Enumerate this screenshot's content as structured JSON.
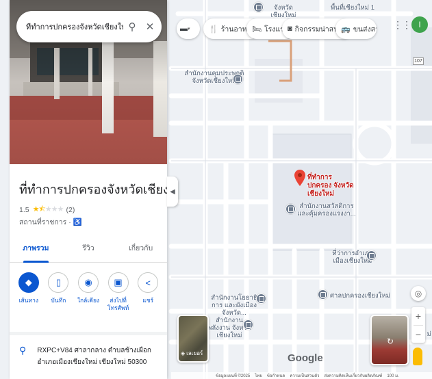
{
  "search": {
    "value": "ที่ทำการปกครองจังหวัดเชียงใหม่",
    "search_icon": "search-icon",
    "close_icon": "close-icon"
  },
  "place": {
    "title": "ที่ทำการปกครองจังหวัดเชียงใหม่",
    "rating": "1.5",
    "reviews": "(2)",
    "stars": 1.5,
    "category": "สถานที่ราชการ ·",
    "accessible_icon": "wheelchair-icon",
    "address": "RXPC+V84 ศาลากลาง ตำบลช้างเผือก อำเภอเมืองเชียงใหม่ เชียงใหม่ 50300"
  },
  "tabs": [
    {
      "label": "ภาพรวม",
      "active": true
    },
    {
      "label": "รีวิว",
      "active": false
    },
    {
      "label": "เกี่ยวกับ",
      "active": false
    }
  ],
  "actions": [
    {
      "label": "เส้นทาง",
      "icon": "directions-icon"
    },
    {
      "label": "บันทึก",
      "icon": "bookmark-icon"
    },
    {
      "label": "ใกล้เคียง",
      "icon": "nearby-icon"
    },
    {
      "label": "ส่งไปที่โทรศัพท์",
      "icon": "send-to-phone-icon"
    },
    {
      "label": "แชร์",
      "icon": "share-icon"
    }
  ],
  "chips": [
    {
      "label": "ร้านอาหาร",
      "icon": "restaurant-icon"
    },
    {
      "label": "โรงแรม",
      "icon": "hotel-icon"
    },
    {
      "label": "กิจกรรมน่าสนใจ",
      "icon": "camera-icon"
    },
    {
      "label": "ขนส่งสา",
      "icon": "transit-icon"
    }
  ],
  "map": {
    "labels": [
      "สำนักงานคุมประพฤติ จังหวัดเชียงใหม่",
      "สำนักงานสวัสดิการ และคุ้มครองแรงงา...",
      "ที่ว่าการอำเภอ เมืองเชียงใหม่",
      "ศาลปกครองเชียงใหม่",
      "สำนักงานโยธาธิการ และผังเมือง จังหวัด...",
      "สำนักงานพลังงาน จังหวัดเชียงใหม่",
      "จังหวัดเชียงใหม่",
      "พื้นที่เชียงใหม่ 1",
      "ศาลปกครองเชียงใหม่"
    ],
    "pin_label": "ที่ทำการปกครอง จังหวัดเชียงใหม่",
    "road_badge": "107",
    "right_label": "ฉ ม่",
    "layers_label": "เลเยอร์",
    "google_logo": "Google",
    "avatar_letter": "I",
    "colors": {
      "road": "#ffffff",
      "land": "#eef1f5",
      "pin": "#ea4335",
      "accent": "#0b57d0"
    }
  },
  "footer": {
    "imagery": "ข้อมูลแผนที่ ©2025",
    "lang": "ไทย",
    "terms": "ข้อกำหนด",
    "privacy": "ความเป็นส่วนตัว",
    "feedback": "ส่งความคิดเห็นเกี่ยวกับผลิตภัณฑ์",
    "scale": "100 ม."
  }
}
